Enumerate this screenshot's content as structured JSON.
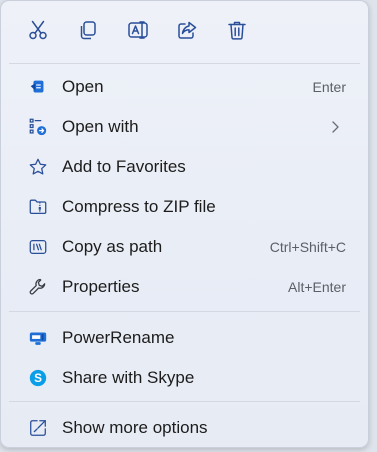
{
  "toolbar": {
    "buttons": [
      {
        "name": "cut",
        "icon": "scissors-icon"
      },
      {
        "name": "copy",
        "icon": "copy-icon"
      },
      {
        "name": "rename",
        "icon": "rename-icon"
      },
      {
        "name": "share",
        "icon": "share-icon"
      },
      {
        "name": "delete",
        "icon": "trash-icon"
      }
    ]
  },
  "menu": {
    "open": {
      "label": "Open",
      "shortcut": "Enter",
      "icon": "open-app-icon"
    },
    "open_with": {
      "label": "Open with",
      "icon": "open-with-icon"
    },
    "favorites": {
      "label": "Add to Favorites",
      "icon": "star-icon"
    },
    "compress": {
      "label": "Compress to ZIP file",
      "icon": "zip-folder-icon"
    },
    "copy_path": {
      "label": "Copy as path",
      "shortcut": "Ctrl+Shift+C",
      "icon": "path-icon"
    },
    "properties": {
      "label": "Properties",
      "shortcut": "Alt+Enter",
      "icon": "wrench-icon"
    },
    "powerrename": {
      "label": "PowerRename",
      "icon": "powerrename-icon"
    },
    "skype": {
      "label": "Share with Skype",
      "icon": "skype-icon"
    },
    "more": {
      "label": "Show more options",
      "icon": "more-options-icon"
    }
  },
  "colors": {
    "accent": "#1f6fd6",
    "skype": "#0a9ee8",
    "icon_stroke": "#2a4f9a"
  }
}
